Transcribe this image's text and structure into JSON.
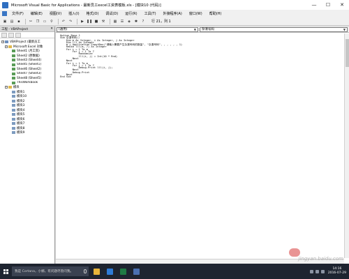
{
  "window": {
    "title": "Microsoft Visual Basic for Applications - 最新员工excel工资表模板.xls - [模块10 (代码)]",
    "minimize_glyph": "—",
    "maximize_glyph": "☐",
    "close_glyph": "✕"
  },
  "menu": {
    "items": [
      {
        "label": "文件(F)"
      },
      {
        "label": "编辑(E)"
      },
      {
        "label": "视图(V)"
      },
      {
        "label": "插入(I)"
      },
      {
        "label": "格式(O)"
      },
      {
        "label": "调试(D)"
      },
      {
        "label": "运行(R)"
      },
      {
        "label": "工具(T)"
      },
      {
        "label": "外接程序(A)"
      },
      {
        "label": "窗口(W)"
      },
      {
        "label": "帮助(H)"
      }
    ]
  },
  "toolbar": {
    "cursor_position": "行 21，列 1"
  },
  "project_panel": {
    "title": "工程 - VBAProject",
    "close_glyph": "✕",
    "tree": [
      {
        "indent": 0,
        "toggle": "−",
        "icon": "proj",
        "label": "VBAProject (最新员工"
      },
      {
        "indent": 1,
        "toggle": "−",
        "icon": "folder",
        "label": "Microsoft Excel 对象"
      },
      {
        "indent": 2,
        "toggle": "",
        "icon": "sheet",
        "label": "Sheet1 (月工资)"
      },
      {
        "indent": 2,
        "toggle": "",
        "icon": "sheet",
        "label": "Sheet2 (原数据)"
      },
      {
        "indent": 2,
        "toggle": "",
        "icon": "sheet",
        "label": "Sheet3 (Sheet4)"
      },
      {
        "indent": 2,
        "toggle": "",
        "icon": "sheet",
        "label": "Sheet5 (Sheet1)"
      },
      {
        "indent": 2,
        "toggle": "",
        "icon": "sheet",
        "label": "Sheet6 (Sheet2)"
      },
      {
        "indent": 2,
        "toggle": "",
        "icon": "sheet",
        "label": "Sheet7 (Sheet3)"
      },
      {
        "indent": 2,
        "toggle": "",
        "icon": "sheet",
        "label": "Sheet8 (Sheet5)"
      },
      {
        "indent": 2,
        "toggle": "",
        "icon": "sheet",
        "label": "ThisWorkbook"
      },
      {
        "indent": 1,
        "toggle": "−",
        "icon": "folder",
        "label": "模块"
      },
      {
        "indent": 2,
        "toggle": "",
        "icon": "module",
        "label": "模块1"
      },
      {
        "indent": 2,
        "toggle": "",
        "icon": "module",
        "label": "模块10"
      },
      {
        "indent": 2,
        "toggle": "",
        "icon": "module",
        "label": "模块2"
      },
      {
        "indent": 2,
        "toggle": "",
        "icon": "module",
        "label": "模块3"
      },
      {
        "indent": 2,
        "toggle": "",
        "icon": "module",
        "label": "模块4"
      },
      {
        "indent": 2,
        "toggle": "",
        "icon": "module",
        "label": "模块5"
      },
      {
        "indent": 2,
        "toggle": "",
        "icon": "module",
        "label": "模块6"
      },
      {
        "indent": 2,
        "toggle": "",
        "icon": "module",
        "label": "模块7"
      },
      {
        "indent": 2,
        "toggle": "",
        "icon": "module",
        "label": "模块8"
      },
      {
        "indent": 2,
        "toggle": "",
        "icon": "module",
        "label": "模块9"
      }
    ]
  },
  "code_window": {
    "object_combo": "(通用)",
    "procedure_combo": "杂凑号码",
    "combo_arrow": "▼",
    "lines": [
      "Option Base 1",
      "Sub 杂凑号码()",
      "    Dim m As Integer, i As Integer, j As Integer",
      "    Dim lll As Integer",
      "    m = Application.InputBox(\"请输入需要产生杂凑号码的数量\", \"杂凑号码\", , , , , , 1)",
      "    ReDim lll(m, 7) As Integer",
      "    For i = 1 To m",
      "        For j = 1 To 7",
      "            Randomize",
      "            lll(i, j) = Int(10 * Rnd)",
      "        Next",
      "    Next",
      "    For i = 1 To m",
      "        For j = 1 To 7",
      "            Debug.Print lll(i, j);",
      "        Next",
      "        Debug.Print",
      "    Next",
      "End Sub"
    ]
  },
  "taskbar": {
    "search_placeholder": "我是 Cortana，小娜。有问题尽管问我。",
    "time": "14:16",
    "date": "2016-07-29",
    "apps": [
      {
        "name": "file-explorer-app-icon",
        "color": "#e8b43a"
      },
      {
        "name": "browser-app-icon",
        "color": "#2e7bd6"
      },
      {
        "name": "excel-app-icon",
        "color": "#1f7a44"
      },
      {
        "name": "vba-editor-app-icon",
        "color": "#4a6fb0"
      }
    ]
  },
  "watermark": {
    "text": "jingyan.baidu.com"
  }
}
